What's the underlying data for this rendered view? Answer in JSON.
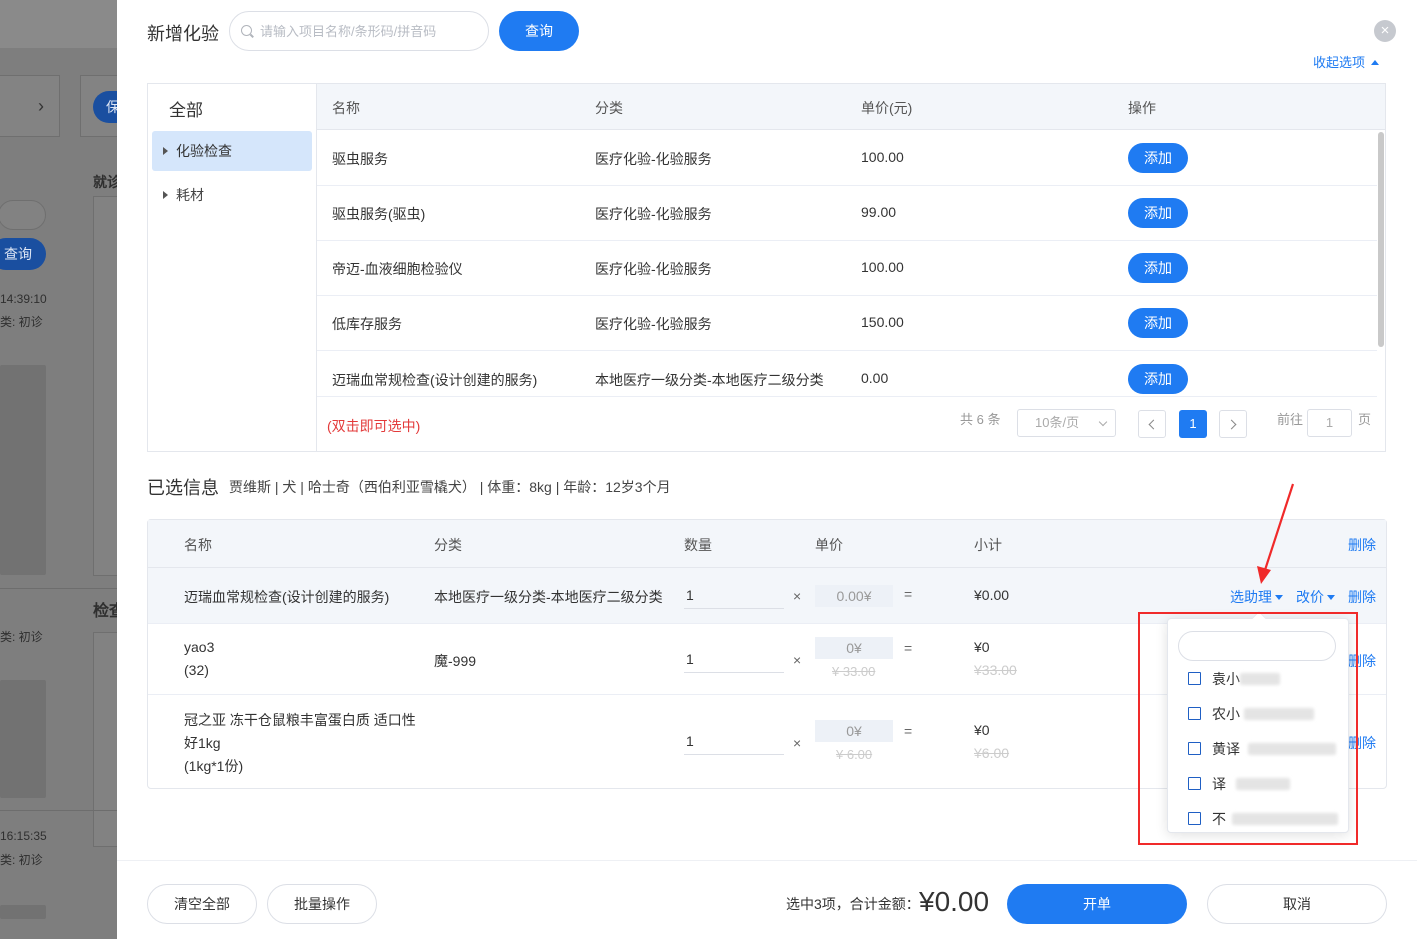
{
  "background": {
    "breadcrumb_chevron": "›",
    "pill_label": "保",
    "section_label_1": "就诊",
    "query_button": "查询",
    "time_1": "14:39:10",
    "type_1": "类: 初诊",
    "section_label_2": "检查",
    "type_2": "类: 初诊",
    "time_2": "16:15:35",
    "type_3": "类: 初诊"
  },
  "modal": {
    "title": "新增化验",
    "search_placeholder": "请输入项目名称/条形码/拼音码",
    "search_button": "查询",
    "close_glyph": "×",
    "collapse_label": "收起选项"
  },
  "categories": {
    "all_label": "全部",
    "items": [
      {
        "label": "化验检查",
        "active": true
      },
      {
        "label": "耗材",
        "active": false
      }
    ]
  },
  "product_table": {
    "headers": [
      "名称",
      "分类",
      "单价(元)",
      "操作"
    ],
    "add_label": "添加",
    "rows": [
      {
        "name": "驱虫服务",
        "category": "医疗化验-化验服务",
        "price": "100.00"
      },
      {
        "name": "驱虫服务(驱虫)",
        "category": "医疗化验-化验服务",
        "price": "99.00"
      },
      {
        "name": "帝迈-血液细胞检验仪",
        "category": "医疗化验-化验服务",
        "price": "100.00"
      },
      {
        "name": "低库存服务",
        "category": "医疗化验-化验服务",
        "price": "150.00"
      },
      {
        "name": "迈瑞血常规检查(设计创建的服务)",
        "category": "本地医疗一级分类-本地医疗二级分类",
        "price": "0.00"
      }
    ],
    "hint": "(双击即可选中)"
  },
  "pagination": {
    "total": "共 6 条",
    "page_size": "10条/页",
    "current_page": "1",
    "goto_label": "前往",
    "goto_value": "1",
    "page_suffix": "页"
  },
  "selected": {
    "title": "已选信息",
    "info": "贾维斯 | 犬 | 哈士奇（西伯利亚雪橇犬） | 体重：8kg | 年龄：12岁3个月",
    "headers": {
      "name": "名称",
      "category": "分类",
      "qty": "数量",
      "price": "单价",
      "subtotal": "小计",
      "delete_all": "删除"
    },
    "times_sign": "×",
    "equals_sign": "=",
    "rows": [
      {
        "name": "迈瑞血常规检查(设计创建的服务)",
        "category": "本地医疗一级分类-本地医疗二级分类",
        "qty": "1",
        "price": "0.00¥",
        "subtotal": "¥0.00",
        "assistant": "选助理",
        "change_price": "改价",
        "delete": "删除"
      },
      {
        "name_line1": "yao3",
        "name_line2": "(32)",
        "category": "魔-999",
        "qty": "1",
        "price": "0¥",
        "orig_price": "¥ 33.00",
        "subtotal": "¥0",
        "orig_subtotal": "¥33.00",
        "delete": "删除"
      },
      {
        "name_line1": "冠之亚 冻干仓鼠粮丰富蛋白质 适口性",
        "name_line2": "好1kg",
        "name_line3": "(1kg*1份)",
        "qty": "1",
        "price": "0¥",
        "orig_price": "¥ 6.00",
        "subtotal": "¥0",
        "orig_subtotal": "¥6.00",
        "delete": "删除"
      }
    ]
  },
  "assistant_dropdown": {
    "search_value": "",
    "options": [
      "袁小",
      "农小",
      "黄译",
      "译",
      "不"
    ]
  },
  "footer": {
    "clear_all": "清空全部",
    "batch_ops": "批量操作",
    "summary": "选中3项，合计金额：",
    "total_amount": "¥0.00",
    "submit": "开单",
    "cancel": "取消"
  },
  "colors": {
    "primary": "#1f7bf2",
    "annotation_red": "#f02a2a",
    "hint_red": "#e33a3a"
  }
}
